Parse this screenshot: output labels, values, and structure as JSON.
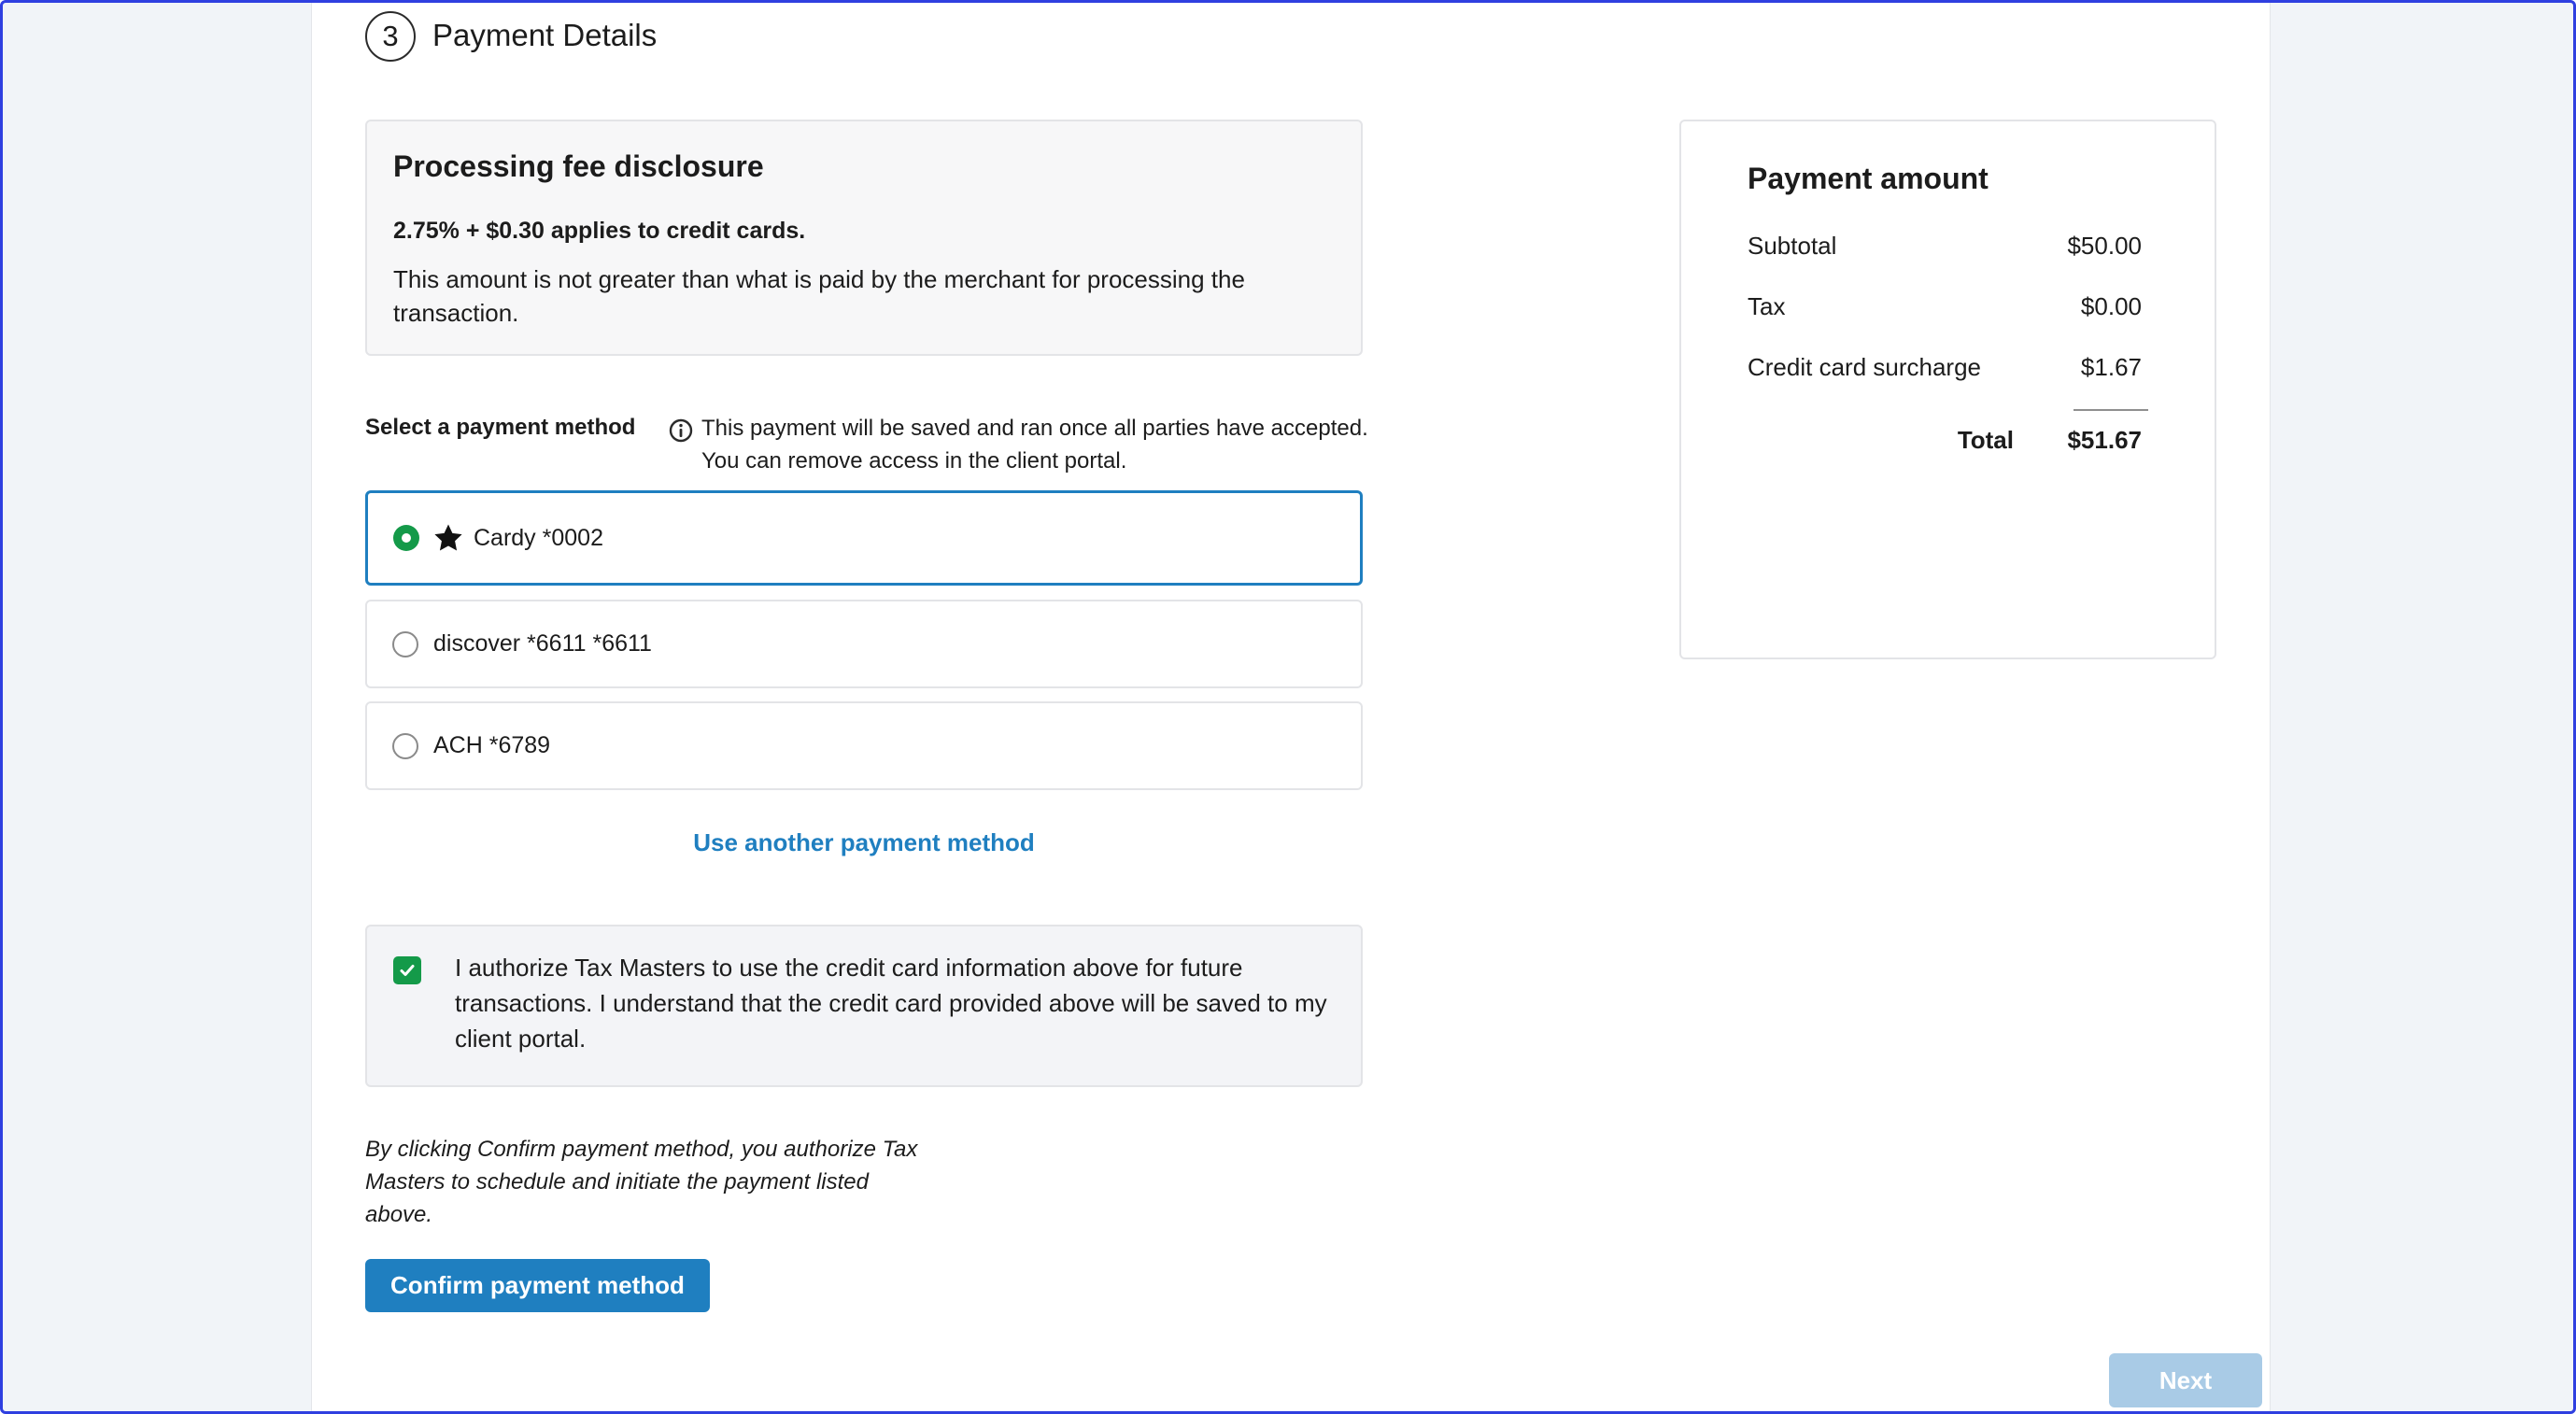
{
  "step": {
    "number": "3",
    "title": "Payment Details"
  },
  "fee_disclosure": {
    "title": "Processing fee disclosure",
    "rate": "2.75% + $0.30 applies to credit cards.",
    "text": "This amount is not greater than what is paid by the merchant for processing the transaction."
  },
  "payment_method": {
    "label": "Select a payment method",
    "info": "This payment will be saved and ran once all parties have accepted. You can remove access in the client portal.",
    "options": [
      {
        "label": "Cardy *0002",
        "selected": true,
        "icon": "star-icon"
      },
      {
        "label": "discover *6611 *6611",
        "selected": false
      },
      {
        "label": "ACH *6789",
        "selected": false
      }
    ],
    "another_link": "Use another payment method"
  },
  "authorization": {
    "checked": true,
    "text": "I authorize Tax Masters to use the credit card information above for future transactions. I understand that the credit card provided above will be saved to my client portal."
  },
  "disclaimer": "By clicking Confirm payment method, you authorize Tax Masters to schedule and initiate the payment listed above.",
  "buttons": {
    "confirm": "Confirm payment method",
    "next": "Next"
  },
  "amount": {
    "title": "Payment amount",
    "rows": [
      {
        "label": "Subtotal",
        "value": "$50.00"
      },
      {
        "label": "Tax",
        "value": "$0.00"
      },
      {
        "label": "Credit card surcharge",
        "value": "$1.67"
      }
    ],
    "total_label": "Total",
    "total_value": "$51.67"
  },
  "colors": {
    "accent": "#1f7fc0",
    "success": "#149a49",
    "disabled_button": "#a9cbe6",
    "frame_border": "#2f3fe0"
  }
}
